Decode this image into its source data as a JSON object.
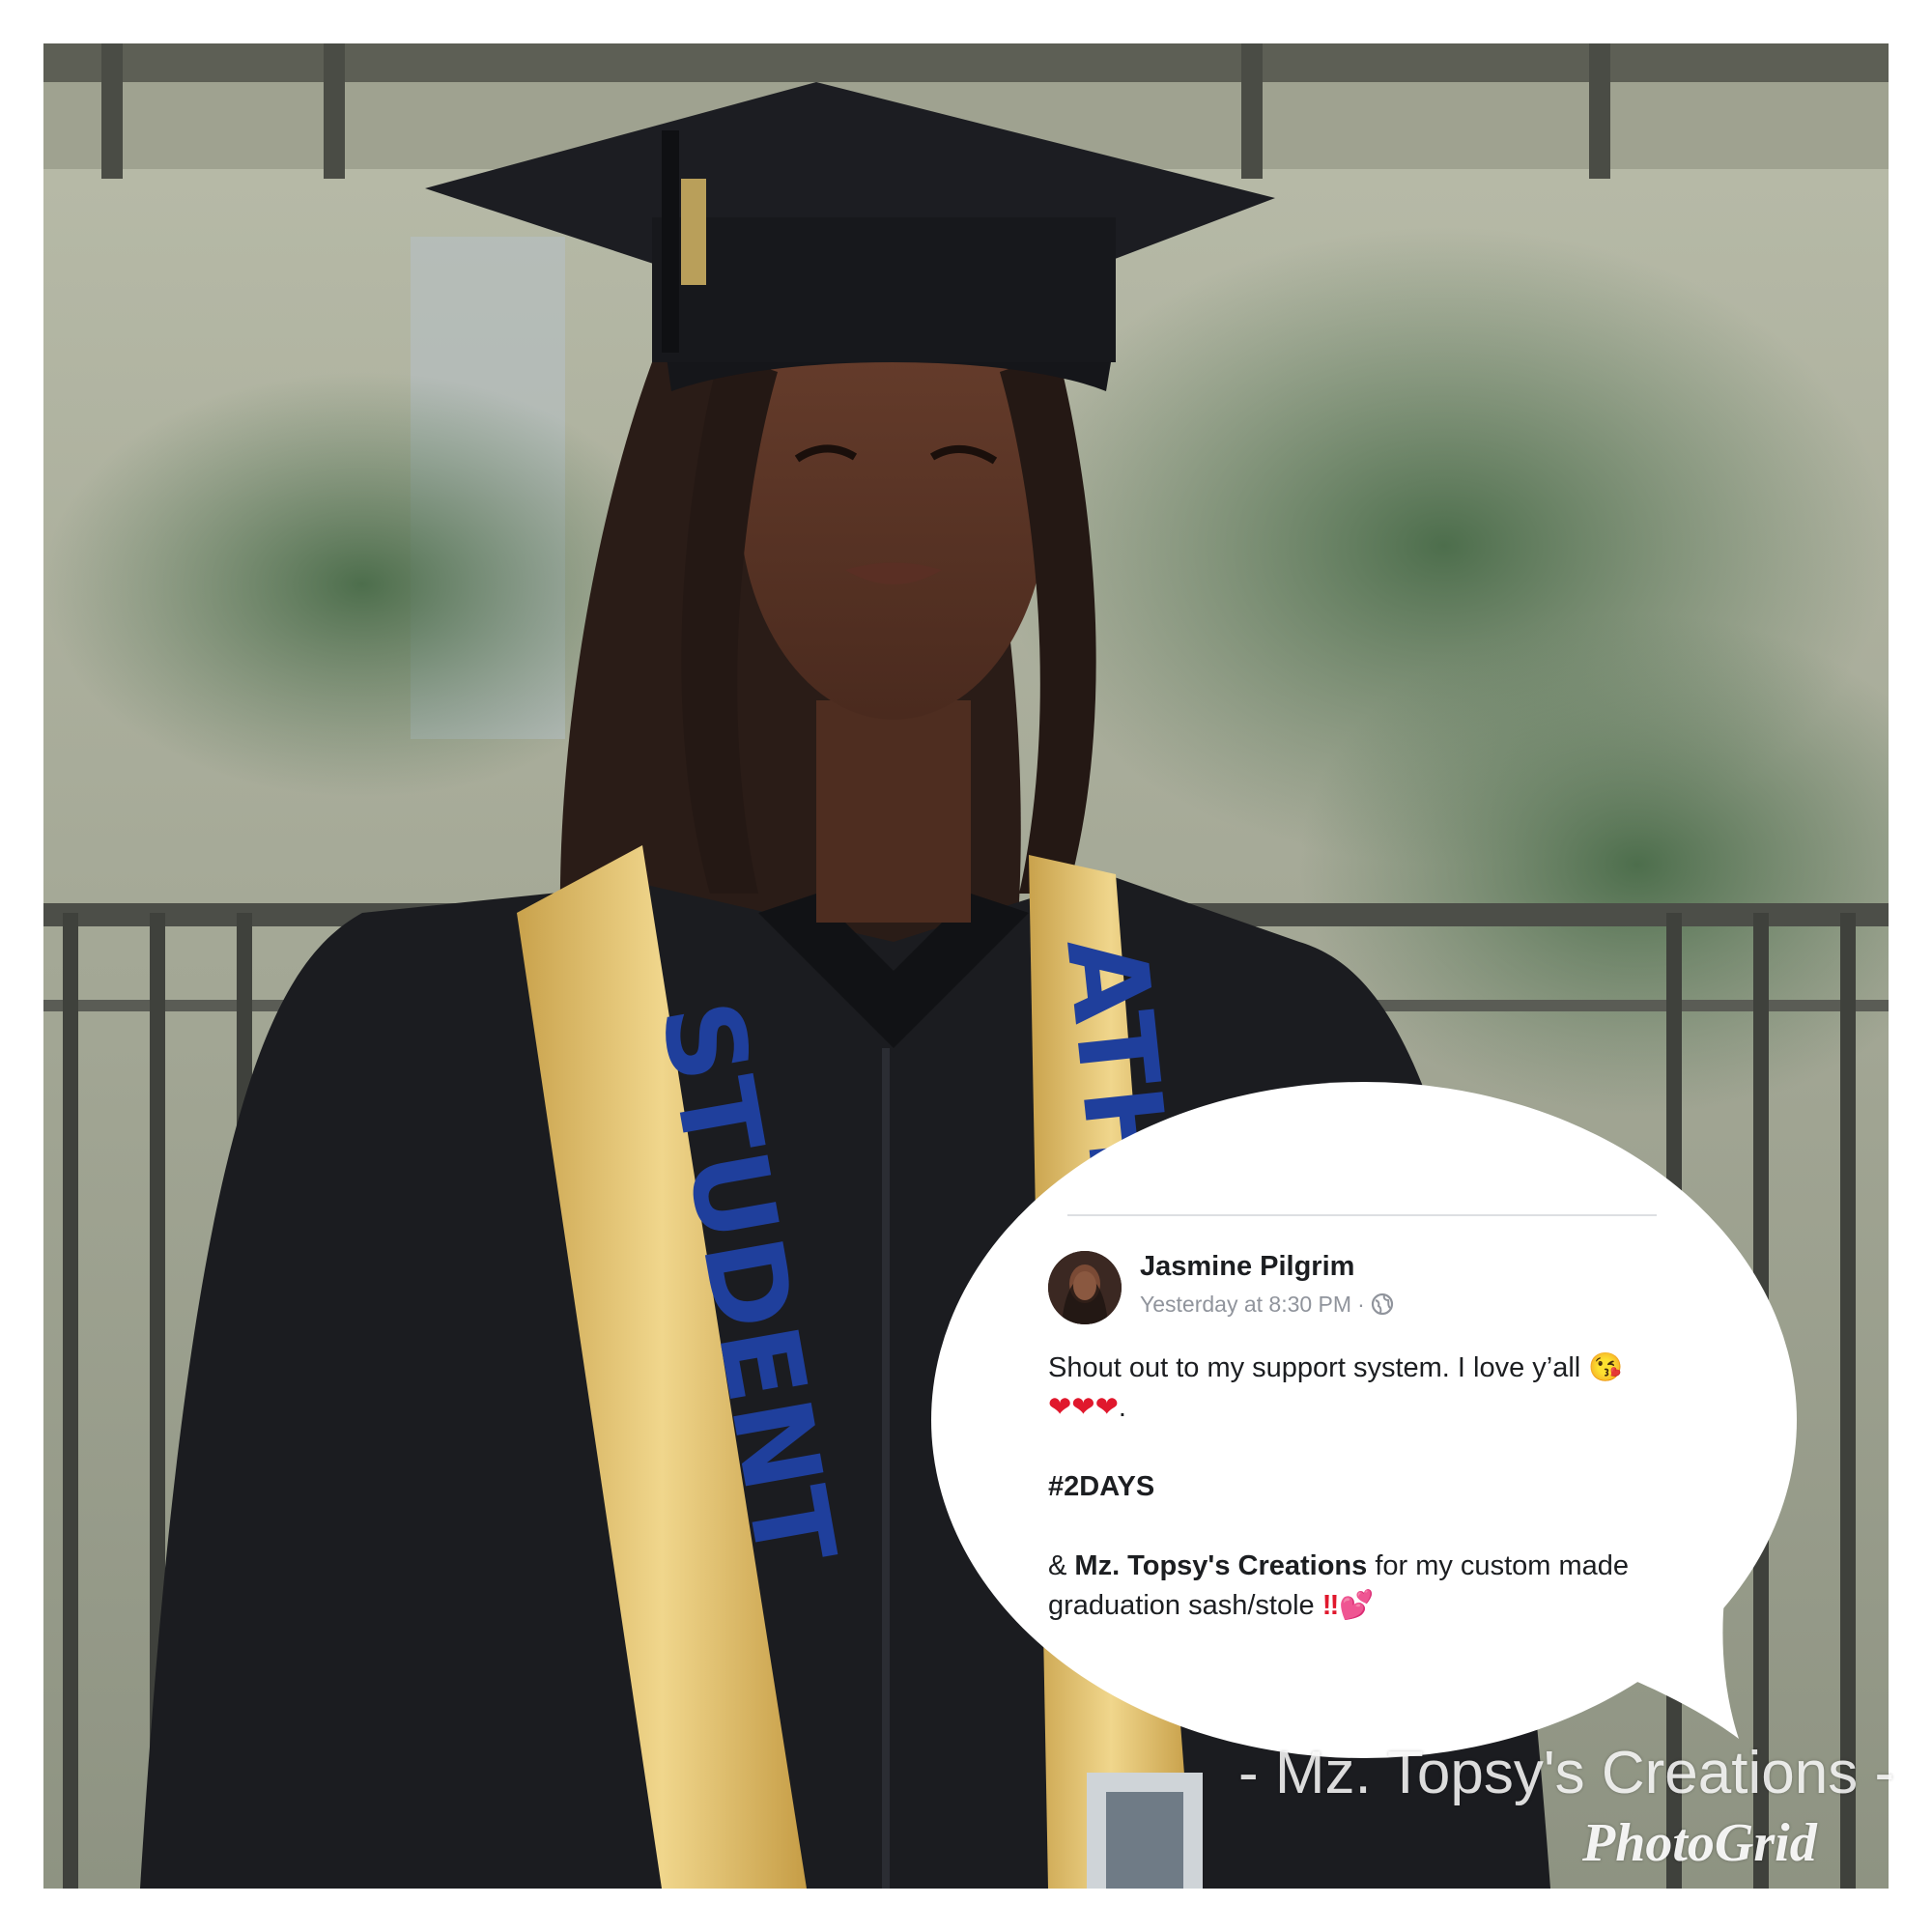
{
  "photo": {
    "sash_left_text": "STUDENT",
    "sash_right_text": "ATH"
  },
  "post": {
    "author": "Jasmine Pilgrim",
    "timestamp": "Yesterday at 8:30 PM",
    "separator": "·",
    "privacy_icon": "globe-icon",
    "line1": "Shout out to my support system. I love y’all",
    "emoji_kiss": "😘",
    "hearts": "❤❤❤",
    "period": ".",
    "hashtag": "#2DAYS",
    "thanks_prefix": "& ",
    "thanks_name": "Mz. Topsy's Creations",
    "thanks_rest": " for my custom made graduation sash/stole ",
    "bang": "‼",
    "emoji_hearts": "💕"
  },
  "watermark": {
    "brand": "- Mz. Topsy's Creations -",
    "app": "PhotoGrid"
  },
  "colors": {
    "sash_gold": "#e5c36a",
    "sash_letters": "#1f3f9c",
    "gown": "#1b1c20"
  }
}
